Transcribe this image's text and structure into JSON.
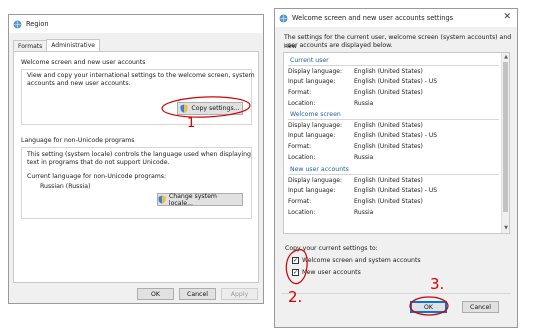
{
  "region_window": {
    "title": "Region",
    "tabs": [
      {
        "label": "Formats",
        "active": false
      },
      {
        "label": "Administrative",
        "active": true
      }
    ],
    "welcome_group": {
      "title": "Welcome screen and new user accounts",
      "description_line1": "View and copy your international settings to the welcome screen, system",
      "description_line2": "accounts and new user accounts.",
      "copy_button": "Copy settings..."
    },
    "unicode_group": {
      "title": "Language for non-Unicode programs",
      "description_line1": "This setting (system locale) controls the language used when displaying",
      "description_line2": "text in programs that do not support Unicode.",
      "current_label": "Current language for non-Unicode programs:",
      "current_value": "Russian (Russia)",
      "change_button": "Change system locale..."
    },
    "buttons": {
      "ok": "OK",
      "cancel": "Cancel",
      "apply": "Apply"
    }
  },
  "settings_window": {
    "title": "Welcome screen and new user accounts settings",
    "intro_line1": "The settings for the current user, welcome screen (system accounts) and new",
    "intro_line2": "user accounts are displayed below.",
    "field_labels": {
      "display_language": "Display language:",
      "input_language": "Input language:",
      "format": "Format:",
      "location": "Location:"
    },
    "sections": [
      {
        "title": "Current user",
        "display_language": "English (United States)",
        "input_language": "English (United States) - US",
        "format": "English (United States)",
        "location": "Russia"
      },
      {
        "title": "Welcome screen",
        "display_language": "English (United States)",
        "input_language": "English (United States) - US",
        "format": "English (United States)",
        "location": "Russia"
      },
      {
        "title": "New user accounts",
        "display_language": "English (United States)",
        "input_language": "English (United States) - US",
        "format": "English (United States)",
        "location": "Russia"
      }
    ],
    "copy_label": "Copy your current settings to:",
    "checkboxes": [
      {
        "label": "Welcome screen and system accounts",
        "checked": true
      },
      {
        "label": "New user accounts",
        "checked": true
      }
    ],
    "buttons": {
      "ok": "OK",
      "cancel": "Cancel"
    }
  },
  "annotations": {
    "step1": "1",
    "step2": "2.",
    "step3": "3.",
    "color": "#d40000"
  },
  "colors": {
    "section_title": "#1f5fa8",
    "primary_border": "#0078d7",
    "window_bg": "#f0f0f0"
  }
}
